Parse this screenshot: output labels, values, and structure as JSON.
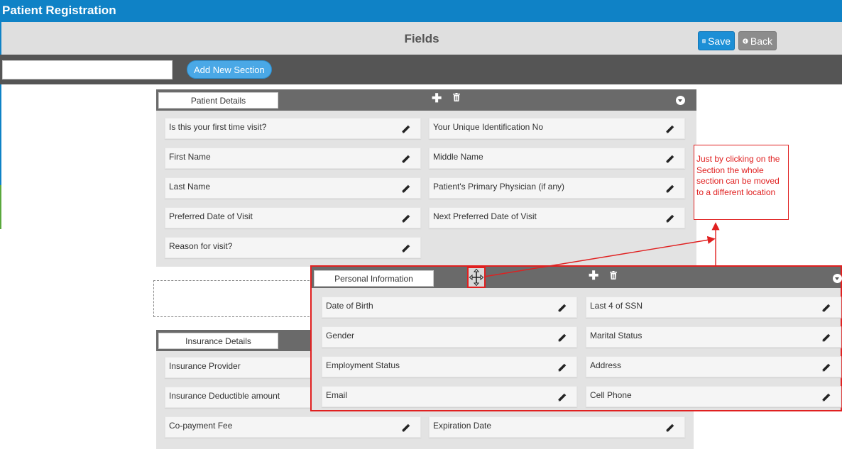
{
  "app": {
    "title": "Patient Registration"
  },
  "header": {
    "title": "Fields",
    "save_label": "Save",
    "back_label": "Back"
  },
  "toolbar": {
    "search_value": "",
    "add_section_label": "Add New Section"
  },
  "sections": {
    "patient_details": {
      "title": "Patient Details",
      "fields": [
        "Is this your first time visit?",
        "Your Unique Identification No",
        "First Name",
        "Middle Name",
        "Last Name",
        "Patient's Primary Physician (if any)",
        "Preferred Date of Visit",
        "Next Preferred Date of Visit",
        "Reason for visit?"
      ]
    },
    "insurance_details": {
      "title": "Insurance Details",
      "fields": [
        "Insurance Provider",
        "Insurance Deductible amount",
        "Co-payment Fee",
        "Expiration Date"
      ]
    },
    "personal_information": {
      "title": "Personal Information",
      "fields": [
        "Date of Birth",
        "Last 4 of SSN",
        "Gender",
        "Marital Status",
        "Employment Status",
        "Address",
        "Email",
        "Cell Phone"
      ]
    }
  },
  "annotation": {
    "text": "Just by clicking on the Section the whole section can be moved to a different location"
  },
  "colors": {
    "titlebar": "#0f82c6",
    "annotation": "#e02020",
    "section_header": "#6a6a6a"
  },
  "icons": [
    "save-icon",
    "back-icon",
    "plus-icon",
    "trash-icon",
    "collapse-icon",
    "pencil-icon",
    "move-icon"
  ]
}
